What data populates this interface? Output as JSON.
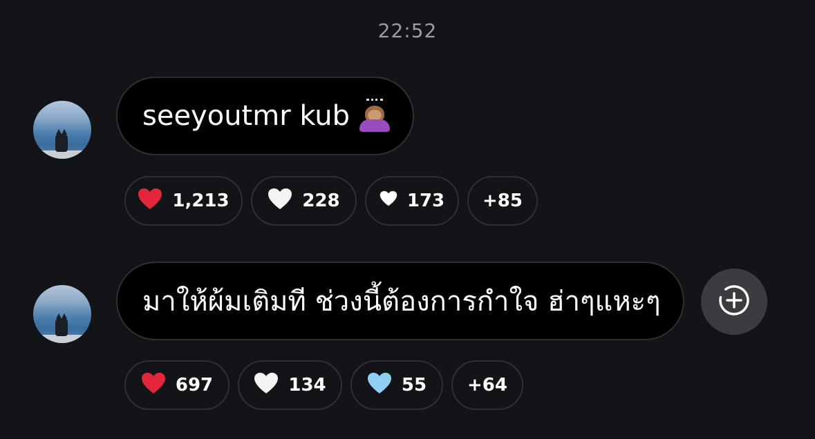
{
  "timestamp": "22:52",
  "messages": [
    {
      "text": "seeyoutmr kub",
      "emoji": "bowing-girl-emoji",
      "reactions": [
        {
          "icon": "red-heart-icon",
          "color": "#e3263b",
          "count": "1,213"
        },
        {
          "icon": "white-heart-icon",
          "color": "#f4f4f4",
          "count": "228"
        },
        {
          "icon": "small-white-heart-icon",
          "color": "#ffffff",
          "count": "173"
        },
        {
          "icon": "",
          "color": "",
          "count": "+85"
        }
      ]
    },
    {
      "text": "มาให้ผ้มเติมที ช่วงนี้ต้องการกำใจ ฮ่าๆแหะๆ",
      "reactions": [
        {
          "icon": "red-heart-icon",
          "color": "#e3263b",
          "count": "697"
        },
        {
          "icon": "white-heart-icon",
          "color": "#f4f4f4",
          "count": "134"
        },
        {
          "icon": "light-blue-heart-icon",
          "color": "#8fd0f3",
          "count": "55"
        },
        {
          "icon": "",
          "color": "",
          "count": "+64"
        }
      ]
    }
  ],
  "add_reaction_icon": "add-reaction-icon",
  "colors": {
    "background": "#121418",
    "bubble": "#000000",
    "border": "#2e3035",
    "timestamp": "#9a9da5"
  }
}
